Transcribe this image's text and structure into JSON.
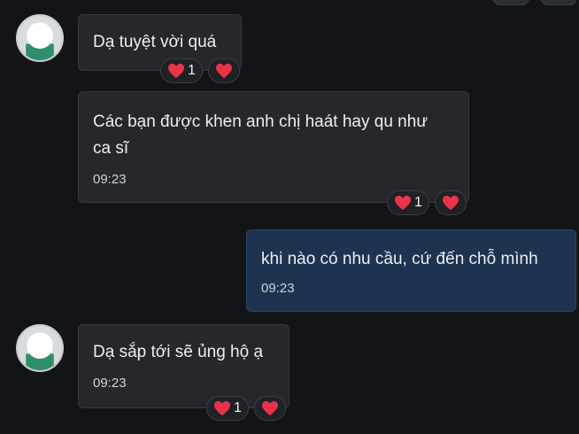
{
  "messages": [
    {
      "id": "m1",
      "text": "Dạ tuyệt vời quá",
      "time": "",
      "reaction_count": "1"
    },
    {
      "id": "m2",
      "line1": "Các bạn được khen anh chị haát hay qu như",
      "line2": "ca sĩ",
      "time": "09:23",
      "reaction_count": "1"
    },
    {
      "id": "m3",
      "text": "khi nào có nhu cầu, cứ đến chỗ mình",
      "time": "09:23"
    },
    {
      "id": "m4",
      "text": "Dạ sắp tới sẽ ủng hộ ạ",
      "time": "09:23",
      "reaction_count": "1"
    }
  ],
  "icons": {
    "reaction": "heart-icon",
    "react_add": "heart-icon"
  },
  "colors": {
    "background": "#121417",
    "incoming_bubble": "#25272b",
    "outgoing_bubble": "#1d3350",
    "heart": "#e8334a"
  }
}
